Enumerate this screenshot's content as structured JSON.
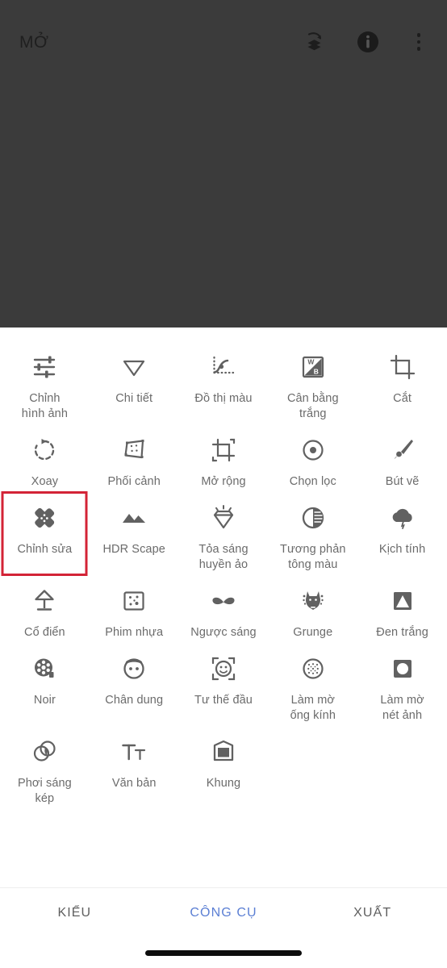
{
  "app": {
    "topbar": {
      "open_label": "MỞ",
      "icons": [
        {
          "name": "undo-layers-icon",
          "label": "Hoàn tác"
        },
        {
          "name": "info-icon",
          "label": "Thông tin"
        },
        {
          "name": "overflow-menu-icon",
          "label": "Trình đơn"
        }
      ]
    }
  },
  "tools": {
    "rows": [
      [
        {
          "icon": "sliders-icon",
          "label": "Chỉnh\nhình ảnh"
        },
        {
          "icon": "triangle-down-icon",
          "label": "Chi tiết"
        },
        {
          "icon": "curve-graph-icon",
          "label": "Đồ thị màu"
        },
        {
          "icon": "white-balance-icon",
          "label": "Cân bằng\ntrắng"
        },
        {
          "icon": "crop-icon",
          "label": "Cắt"
        }
      ],
      [
        {
          "icon": "rotate-icon",
          "label": "Xoay"
        },
        {
          "icon": "perspective-icon",
          "label": "Phối cảnh"
        },
        {
          "icon": "expand-icon",
          "label": "Mở rộng"
        },
        {
          "icon": "selective-icon",
          "label": "Chọn lọc"
        },
        {
          "icon": "brush-icon",
          "label": "Bút vẽ"
        }
      ],
      [
        {
          "icon": "healing-patch-icon",
          "label": "Chỉnh sửa",
          "highlighted": true
        },
        {
          "icon": "mountains-icon",
          "label": "HDR Scape"
        },
        {
          "icon": "glamour-gem-icon",
          "label": "Tỏa sáng\nhuyền ảo"
        },
        {
          "icon": "tonal-contrast-icon",
          "label": "Tương phản\ntông màu"
        },
        {
          "icon": "drama-cloud-icon",
          "label": "Kịch tính"
        }
      ],
      [
        {
          "icon": "lamp-icon",
          "label": "Cổ điển"
        },
        {
          "icon": "grain-square-icon",
          "label": "Phim nhựa"
        },
        {
          "icon": "mustache-icon",
          "label": "Ngược sáng"
        },
        {
          "icon": "grunge-icon",
          "label": "Grunge"
        },
        {
          "icon": "black-white-icon",
          "label": "Đen trắng"
        }
      ],
      [
        {
          "icon": "film-reel-icon",
          "label": "Noir"
        },
        {
          "icon": "portrait-face-icon",
          "label": "Chân dung"
        },
        {
          "icon": "head-pose-icon",
          "label": "Tư thế đầu"
        },
        {
          "icon": "lens-blur-icon",
          "label": "Làm mờ\nống kính"
        },
        {
          "icon": "image-blur-icon",
          "label": "Làm mờ\nnét ảnh"
        }
      ],
      [
        {
          "icon": "double-exposure-icon",
          "label": "Phơi sáng\nkép"
        },
        {
          "icon": "text-icon",
          "label": "Văn bản"
        },
        {
          "icon": "frame-icon",
          "label": "Khung"
        }
      ]
    ]
  },
  "tabbar": {
    "tabs": [
      {
        "label": "KIỂU",
        "active": false
      },
      {
        "label": "CÔNG CỤ",
        "active": true
      },
      {
        "label": "XUẤT",
        "active": false
      }
    ]
  },
  "colors": {
    "canvas_background": "#3b3b3b",
    "panel_background": "#ffffff",
    "icon_gray": "#616161",
    "label_gray": "#6b6b6b",
    "accent_blue": "#5b7fd4",
    "highlight_red": "#d32336"
  }
}
